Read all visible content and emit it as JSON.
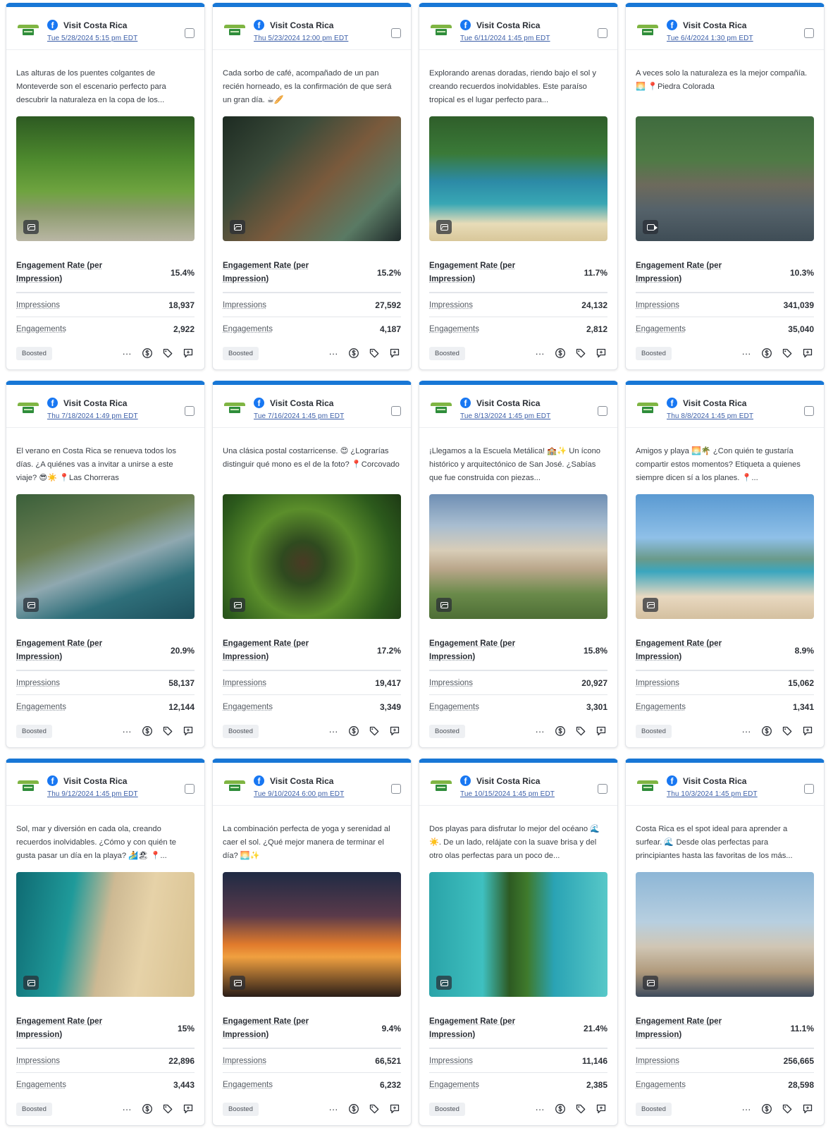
{
  "labels": {
    "engagement_rate": "Engagement Rate (per Impression)",
    "impressions": "Impressions",
    "engagements": "Engagements",
    "boosted": "Boosted",
    "more": "···"
  },
  "icons": {
    "brand_logo": "visit-costa-rica-logo",
    "network": "facebook-icon",
    "media_photo": "image-icon",
    "media_video": "video-icon",
    "more": "more-icon",
    "boost": "dollar-icon",
    "tag": "tag-icon",
    "comment": "comment-icon"
  },
  "colors": {
    "accent": "#1877d6",
    "facebook": "#1877f2",
    "brand_green": "#2f8d3b"
  },
  "posts": [
    {
      "page": "Visit Costa Rica",
      "date": "Tue 5/28/2024 5:15 pm EDT",
      "caption": "Las alturas de los puentes colgantes de Monteverde son el escenario perfecto para descubrir la naturaleza en la copa de los...",
      "media": "photo",
      "engagement_rate": "15.4%",
      "impressions": "18,937",
      "engagements": "2,922"
    },
    {
      "page": "Visit Costa Rica",
      "date": "Thu 5/23/2024 12:00 pm EDT",
      "caption": "Cada sorbo de café, acompañado de un pan recién horneado, es la confirmación de que será un gran día. ☕🥖",
      "media": "photo",
      "engagement_rate": "15.2%",
      "impressions": "27,592",
      "engagements": "4,187"
    },
    {
      "page": "Visit Costa Rica",
      "date": "Tue 6/11/2024 1:45 pm EDT",
      "caption": "Explorando arenas doradas, riendo bajo el sol y creando recuerdos inolvidables. Este paraíso tropical es el lugar perfecto para...",
      "media": "photo",
      "engagement_rate": "11.7%",
      "impressions": "24,132",
      "engagements": "2,812"
    },
    {
      "page": "Visit Costa Rica",
      "date": "Tue 6/4/2024 1:30 pm EDT",
      "caption": "A veces solo la naturaleza es la mejor compañía. 🌅 📍Piedra Colorada",
      "media": "video",
      "engagement_rate": "10.3%",
      "impressions": "341,039",
      "engagements": "35,040"
    },
    {
      "page": "Visit Costa Rica",
      "date": "Thu 7/18/2024 1:49 pm EDT",
      "caption": "El verano en Costa Rica se renueva todos los días. ¿A quiénes vas a invitar a unirse a este viaje? 😎☀️ 📍Las Chorreras",
      "media": "photo",
      "engagement_rate": "20.9%",
      "impressions": "58,137",
      "engagements": "12,144"
    },
    {
      "page": "Visit Costa Rica",
      "date": "Tue 7/16/2024 1:45 pm EDT",
      "caption": "Una clásica postal costarricense. 😍 ¿Lograrías distinguir qué mono es el de la foto? 📍Corcovado",
      "media": "photo",
      "engagement_rate": "17.2%",
      "impressions": "19,417",
      "engagements": "3,349"
    },
    {
      "page": "Visit Costa Rica",
      "date": "Tue 8/13/2024 1:45 pm EDT",
      "caption": "¡Llegamos a la Escuela Metálica! 🏫✨ Un ícono histórico y arquitectónico de San José. ¿Sabías que fue construida con piezas...",
      "media": "photo",
      "engagement_rate": "15.8%",
      "impressions": "20,927",
      "engagements": "3,301"
    },
    {
      "page": "Visit Costa Rica",
      "date": "Thu 8/8/2024 1:45 pm EDT",
      "caption": "Amigos y playa 🌅🌴 ¿Con quién te gustaría compartir estos momentos? Etiqueta a quienes siempre dicen sí a los planes. 📍...",
      "media": "photo",
      "engagement_rate": "8.9%",
      "impressions": "15,062",
      "engagements": "1,341"
    },
    {
      "page": "Visit Costa Rica",
      "date": "Thu 9/12/2024 1:45 pm EDT",
      "caption": "Sol, mar y diversión en cada ola, creando recuerdos inolvidables. ¿Cómo y con quién te gusta pasar un día en la playa? 🏄🏖 📍...",
      "media": "photo",
      "engagement_rate": "15%",
      "impressions": "22,896",
      "engagements": "3,443"
    },
    {
      "page": "Visit Costa Rica",
      "date": "Tue 9/10/2024 6:00 pm EDT",
      "caption": "La combinación perfecta de yoga y serenidad al caer el sol. ¿Qué mejor manera de terminar el día? 🌅✨",
      "media": "photo",
      "engagement_rate": "9.4%",
      "impressions": "66,521",
      "engagements": "6,232"
    },
    {
      "page": "Visit Costa Rica",
      "date": "Tue 10/15/2024 1:45 pm EDT",
      "caption": "Dos playas para disfrutar lo mejor del océano 🌊☀️. De un lado, relájate con la suave brisa y del otro olas perfectas para un poco de...",
      "media": "photo",
      "engagement_rate": "21.4%",
      "impressions": "11,146",
      "engagements": "2,385"
    },
    {
      "page": "Visit Costa Rica",
      "date": "Thu 10/3/2024 1:45 pm EDT",
      "caption": "Costa Rica es el spot ideal para aprender a surfear. 🌊 Desde olas perfectas para principiantes hasta las favoritas de los más...",
      "media": "photo",
      "engagement_rate": "11.1%",
      "impressions": "256,665",
      "engagements": "28,598"
    }
  ]
}
